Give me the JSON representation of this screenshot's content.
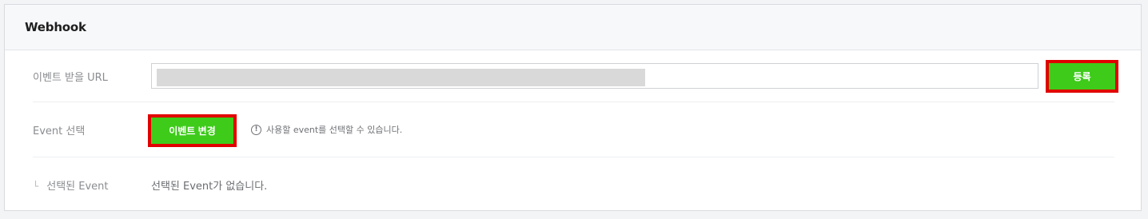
{
  "webhook": {
    "title": "Webhook",
    "url_row": {
      "label": "이벤트 받을 URL",
      "input_value": "",
      "register_label": "등록"
    },
    "event_row": {
      "label": "Event 선택",
      "change_label": "이벤트 변경",
      "info_icon": "!",
      "info_text": "사용할 event를 선택할 수 있습니다."
    },
    "selected_row": {
      "corner_glyph": "└",
      "label": "선택된 Event",
      "empty_text": "선택된 Event가 없습니다."
    }
  },
  "colors": {
    "button_green": "#3ecb1a",
    "highlight_red": "#e10000",
    "header_bg": "#f7f8fa",
    "page_bg": "#f3f4f6"
  }
}
